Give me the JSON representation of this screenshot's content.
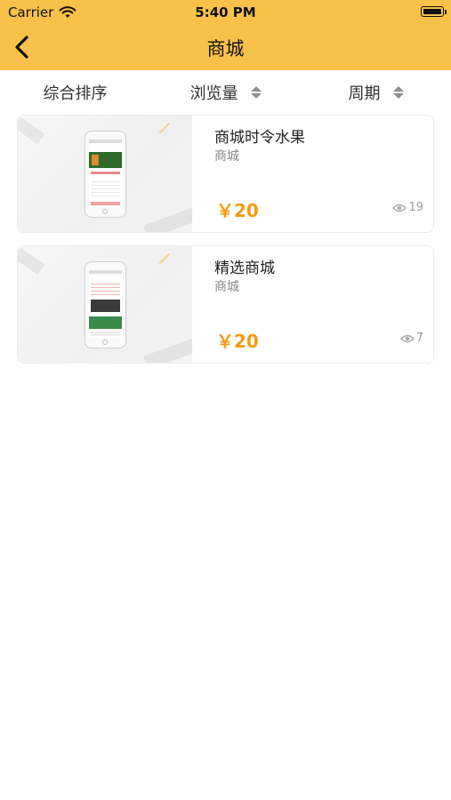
{
  "status": {
    "carrier": "Carrier",
    "time": "5:40 PM"
  },
  "nav": {
    "title": "商城"
  },
  "sort": {
    "items": [
      {
        "label": "综合排序"
      },
      {
        "label": "浏览量"
      },
      {
        "label": "周期"
      }
    ]
  },
  "products": [
    {
      "title": "商城时令水果",
      "category": "商城",
      "price": "￥20",
      "views": "19"
    },
    {
      "title": "精选商城",
      "category": "商城",
      "price": "￥20",
      "views": "7"
    }
  ],
  "colors": {
    "header": "#f8c24a",
    "price": "#f39a10"
  },
  "icons": {
    "back": "chevron-left-icon",
    "views": "eye-icon",
    "sort": "sort-arrows-icon"
  }
}
